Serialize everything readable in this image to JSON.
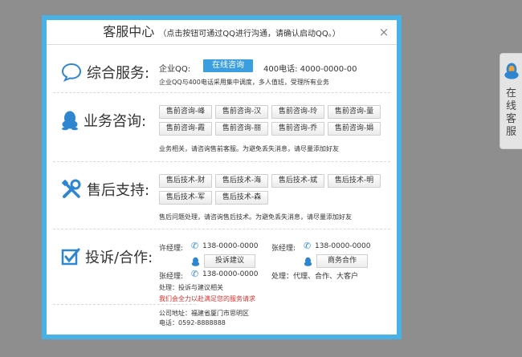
{
  "dialog": {
    "title": "客服中心",
    "subtitle": "（点击按钮可通过QQ进行沟通，请确认启动QQ。）",
    "close": "×"
  },
  "sections": {
    "general": {
      "title": "综合服务:",
      "qq_label": "企业QQ:",
      "online_button": "在线咨询",
      "phone_label": "400电话: 4000-0000-00",
      "note": "企业QQ与400电话采用集中调度，多人值班，受理所有业务"
    },
    "consult": {
      "title": "业务咨询:",
      "buttons": [
        "售前咨询-峰",
        "售前咨询-汉",
        "售前咨询-玲",
        "售前咨询-量",
        "售前咨询-霞",
        "售前咨询-丽",
        "售前咨询-乔",
        "售前咨询-娟"
      ],
      "note": "业务相关，请咨询售前客服。为避免丢失消息，请尽量添加好友"
    },
    "support": {
      "title": "售后支持:",
      "buttons": [
        "售后技术-财",
        "售后技术-海",
        "售后技术-斌",
        "售后技术-明",
        "售后技术-军",
        "售后技术-森"
      ],
      "note": "售后问题处理，请咨询售后技术。为避免丢失消息，请尽量添加好友"
    },
    "complaint": {
      "title": "投诉/合作:",
      "contacts": [
        {
          "name": "许经理:",
          "phone": "138-0000-0000",
          "button": "投诉建议"
        },
        {
          "name": "张经理:",
          "phone": "138-0000-0000",
          "button": "商务合作"
        }
      ],
      "extra_name": "张经理:",
      "extra_phone": "138-0000-0000",
      "handle_left": "处理：投诉与建议相关",
      "handle_right": "处理：代理、合作、大客户",
      "promise": "我们会全力以赴满足您的服务请求"
    }
  },
  "footer": {
    "address": "公司地址：福建省厦门市思明区",
    "phone": "电话：0592-8888888"
  },
  "side_tab": {
    "label": "在线客服"
  },
  "colors": {
    "frame": "#48b1e6",
    "icon_blue": "#2f86d0",
    "button_blue": "#3a9ee0",
    "red": "#d9302c",
    "backdrop": "#8e8e8e"
  }
}
